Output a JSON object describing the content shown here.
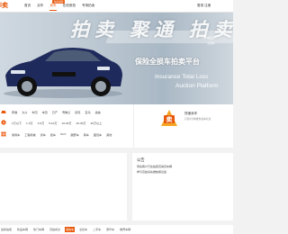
{
  "header": {
    "logo": "l卖",
    "nav": [
      "首页",
      "买车",
      "卖车",
      "在线竞拍",
      "专场拍卖"
    ],
    "active_index": 2,
    "hot_badge": "拍卖保险",
    "login": "登录 注册"
  },
  "banner": {
    "title": "拍卖 聚通 拍卖",
    "subtitle": "保险全损车拍卖平台",
    "en_line1": "Insurance Total Loss",
    "en_line2": "Auction Platform",
    "small1": "二手车拍卖",
    "small2": "全损车"
  },
  "filters": [
    {
      "icon": "car-icon",
      "options": [
        "奔驰",
        "大众",
        "丰田",
        "本田",
        "日产",
        "雪佛兰",
        "别克",
        "宝马",
        "奥迪"
      ]
    },
    {
      "icon": "price-icon",
      "options": [
        "1万以下",
        "1-3万",
        "3-5万",
        "5-10万",
        "10-20万",
        "20-30万",
        "30万以上"
      ]
    },
    {
      "icon": "category-icon",
      "options": [
        "乘用车",
        "工程机械",
        "货车",
        "挂车",
        "SUV",
        "越野车",
        "客车",
        "面包车",
        "其他"
      ]
    }
  ],
  "promo": {
    "title": "快速卖车",
    "text": "只需1分钟发布卖车信息"
  },
  "left_panel": {
    "title": ""
  },
  "notice": {
    "title": "公告",
    "lines": [
      "恭喜客户已在拍卖竞得该车辆",
      "参与竞拍请先缴纳保证金"
    ]
  },
  "footer_tabs": [
    "最新拍卖",
    "新品车辆",
    "热门车辆",
    "竞拍成交",
    "事故车",
    "全损车",
    "二手车",
    "豪华车",
    "推荐车辆"
  ],
  "footer_active_index": 4,
  "colors": {
    "accent": "#e8590c"
  }
}
